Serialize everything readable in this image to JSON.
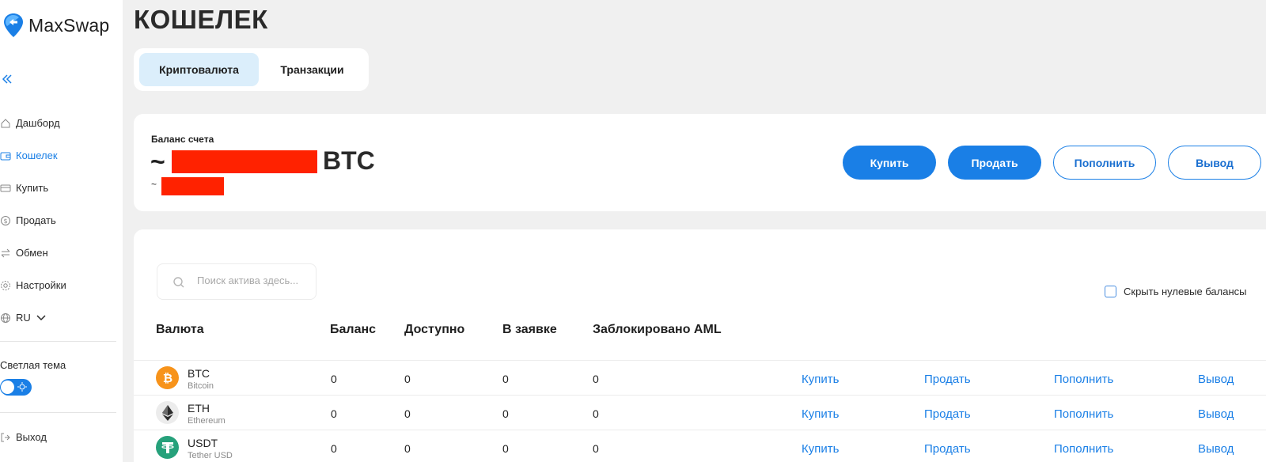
{
  "app": {
    "logo_text": "MaxSwap"
  },
  "sidebar": {
    "items": [
      {
        "label": "Дашборд",
        "icon": "home-icon"
      },
      {
        "label": "Кошелек",
        "icon": "wallet-icon",
        "active": true
      },
      {
        "label": "Купить",
        "icon": "card-icon"
      },
      {
        "label": "Продать",
        "icon": "dollar-icon"
      },
      {
        "label": "Обмен",
        "icon": "exchange-icon"
      },
      {
        "label": "Настройки",
        "icon": "gear-icon"
      }
    ],
    "language": "RU",
    "theme_label": "Светлая тема",
    "logout_label": "Выход"
  },
  "page": {
    "title": "КОШЕЛЕК"
  },
  "tabs": [
    {
      "label": "Криптовалюта",
      "active": true
    },
    {
      "label": "Транзакции",
      "active": false
    }
  ],
  "balance": {
    "label": "Баланс счета",
    "tilde": "~",
    "unit": "BTC",
    "secondary_tilde": "~"
  },
  "actions": {
    "buy": "Купить",
    "sell": "Продать",
    "deposit": "Пополнить",
    "withdraw": "Вывод"
  },
  "search": {
    "placeholder": "Поиск актива здесь..."
  },
  "filter": {
    "hide_zero_label": "Скрыть нулевые балансы"
  },
  "table": {
    "headers": {
      "currency": "Валюта",
      "balance": "Баланс",
      "available": "Доступно",
      "in_order": "В заявке",
      "blocked_aml": "Заблокировано AML"
    },
    "rows": [
      {
        "symbol": "BTC",
        "name": "Bitcoin",
        "balance": "0",
        "available": "0",
        "in_order": "0",
        "blocked": "0",
        "icon": "bitcoin-icon",
        "color": "#f7931a"
      },
      {
        "symbol": "ETH",
        "name": "Ethereum",
        "balance": "0",
        "available": "0",
        "in_order": "0",
        "blocked": "0",
        "icon": "ethereum-icon",
        "color": "#ececec"
      },
      {
        "symbol": "USDT",
        "name": "Tether USD",
        "balance": "0",
        "available": "0",
        "in_order": "0",
        "blocked": "0",
        "icon": "tether-icon",
        "color": "#26a17b"
      }
    ],
    "row_actions": {
      "buy": "Купить",
      "sell": "Продать",
      "deposit": "Пополнить",
      "withdraw": "Вывод"
    }
  },
  "colors": {
    "accent": "#1a7fe6",
    "tab_active_bg": "#dbeefb",
    "redaction": "#ff2200"
  }
}
